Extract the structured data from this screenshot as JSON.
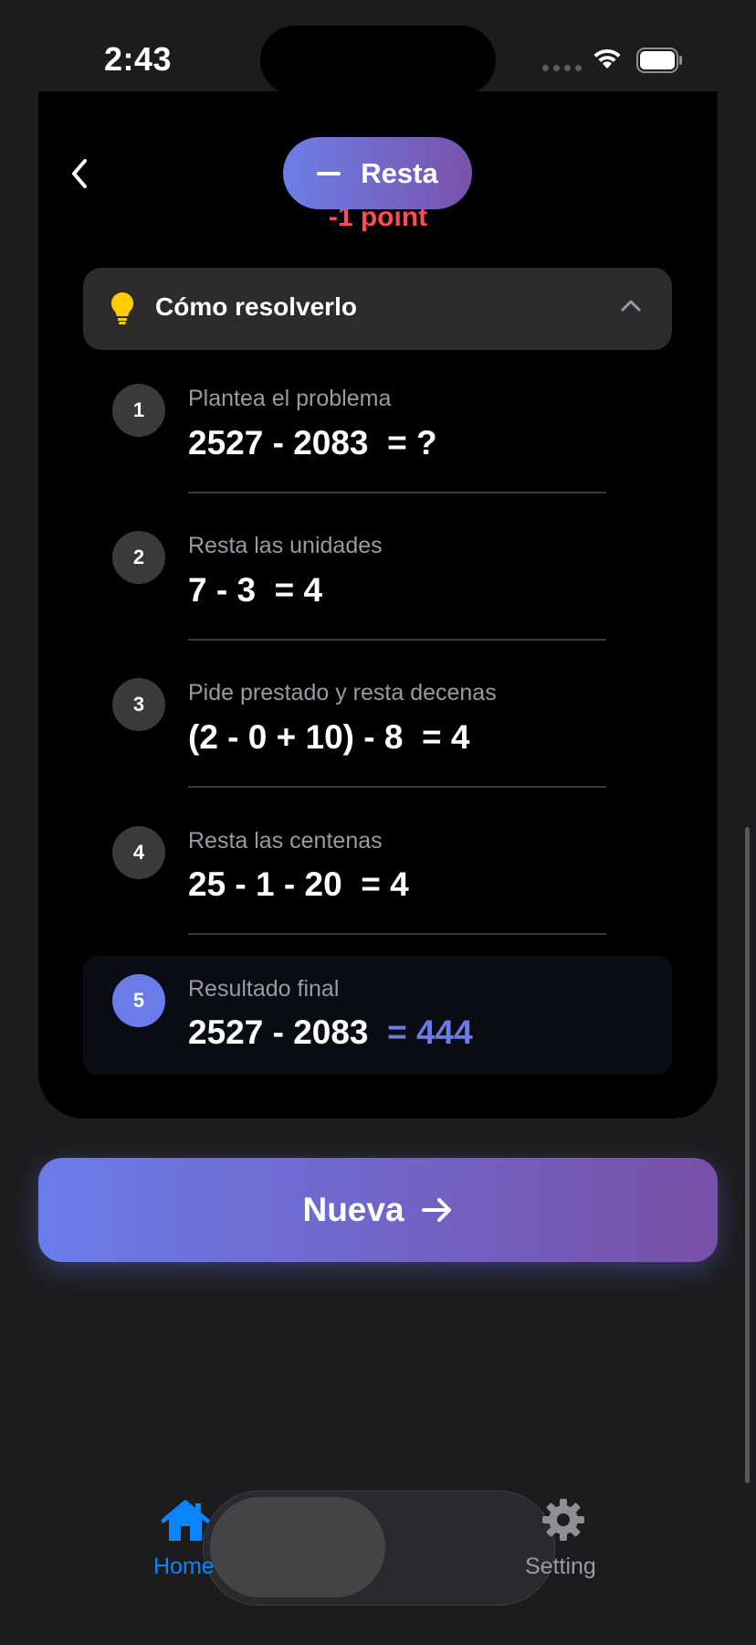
{
  "status_bar": {
    "time": "2:43"
  },
  "header": {
    "back_icon": "chevron-left-icon",
    "operation_icon": "minus-icon",
    "operation_label": "Resta"
  },
  "card": {
    "penalty_text": "-1 point",
    "howto": {
      "icon": "lightbulb-icon",
      "title": "Cómo resolverlo",
      "expanded": true
    },
    "steps": [
      {
        "number": "1",
        "label": "Plantea el problema",
        "expression": "2527 - 2083",
        "result": "= ?"
      },
      {
        "number": "2",
        "label": "Resta las unidades",
        "expression": "7 - 3",
        "result": "= 4"
      },
      {
        "number": "3",
        "label": "Pide prestado y resta decenas",
        "expression": "(2 - 0 + 10) - 8",
        "result": "= 4"
      },
      {
        "number": "4",
        "label": "Resta las centenas",
        "expression": "25 - 1 - 20",
        "result": "= 4"
      },
      {
        "number": "5",
        "label": "Resultado final",
        "expression": "2527 - 2083",
        "result": "= 444"
      }
    ]
  },
  "actions": {
    "new_label": "Nueva",
    "new_icon": "arrow-right-icon"
  },
  "tabbar": {
    "tabs": [
      {
        "label": "Home",
        "icon": "house-icon",
        "selected": true
      },
      {
        "label": "Setting",
        "icon": "gear-icon",
        "selected": false
      }
    ]
  },
  "colors": {
    "accent": "#6b7bea",
    "penalty": "#ff4d4f",
    "tab_active": "#0a84ff"
  }
}
